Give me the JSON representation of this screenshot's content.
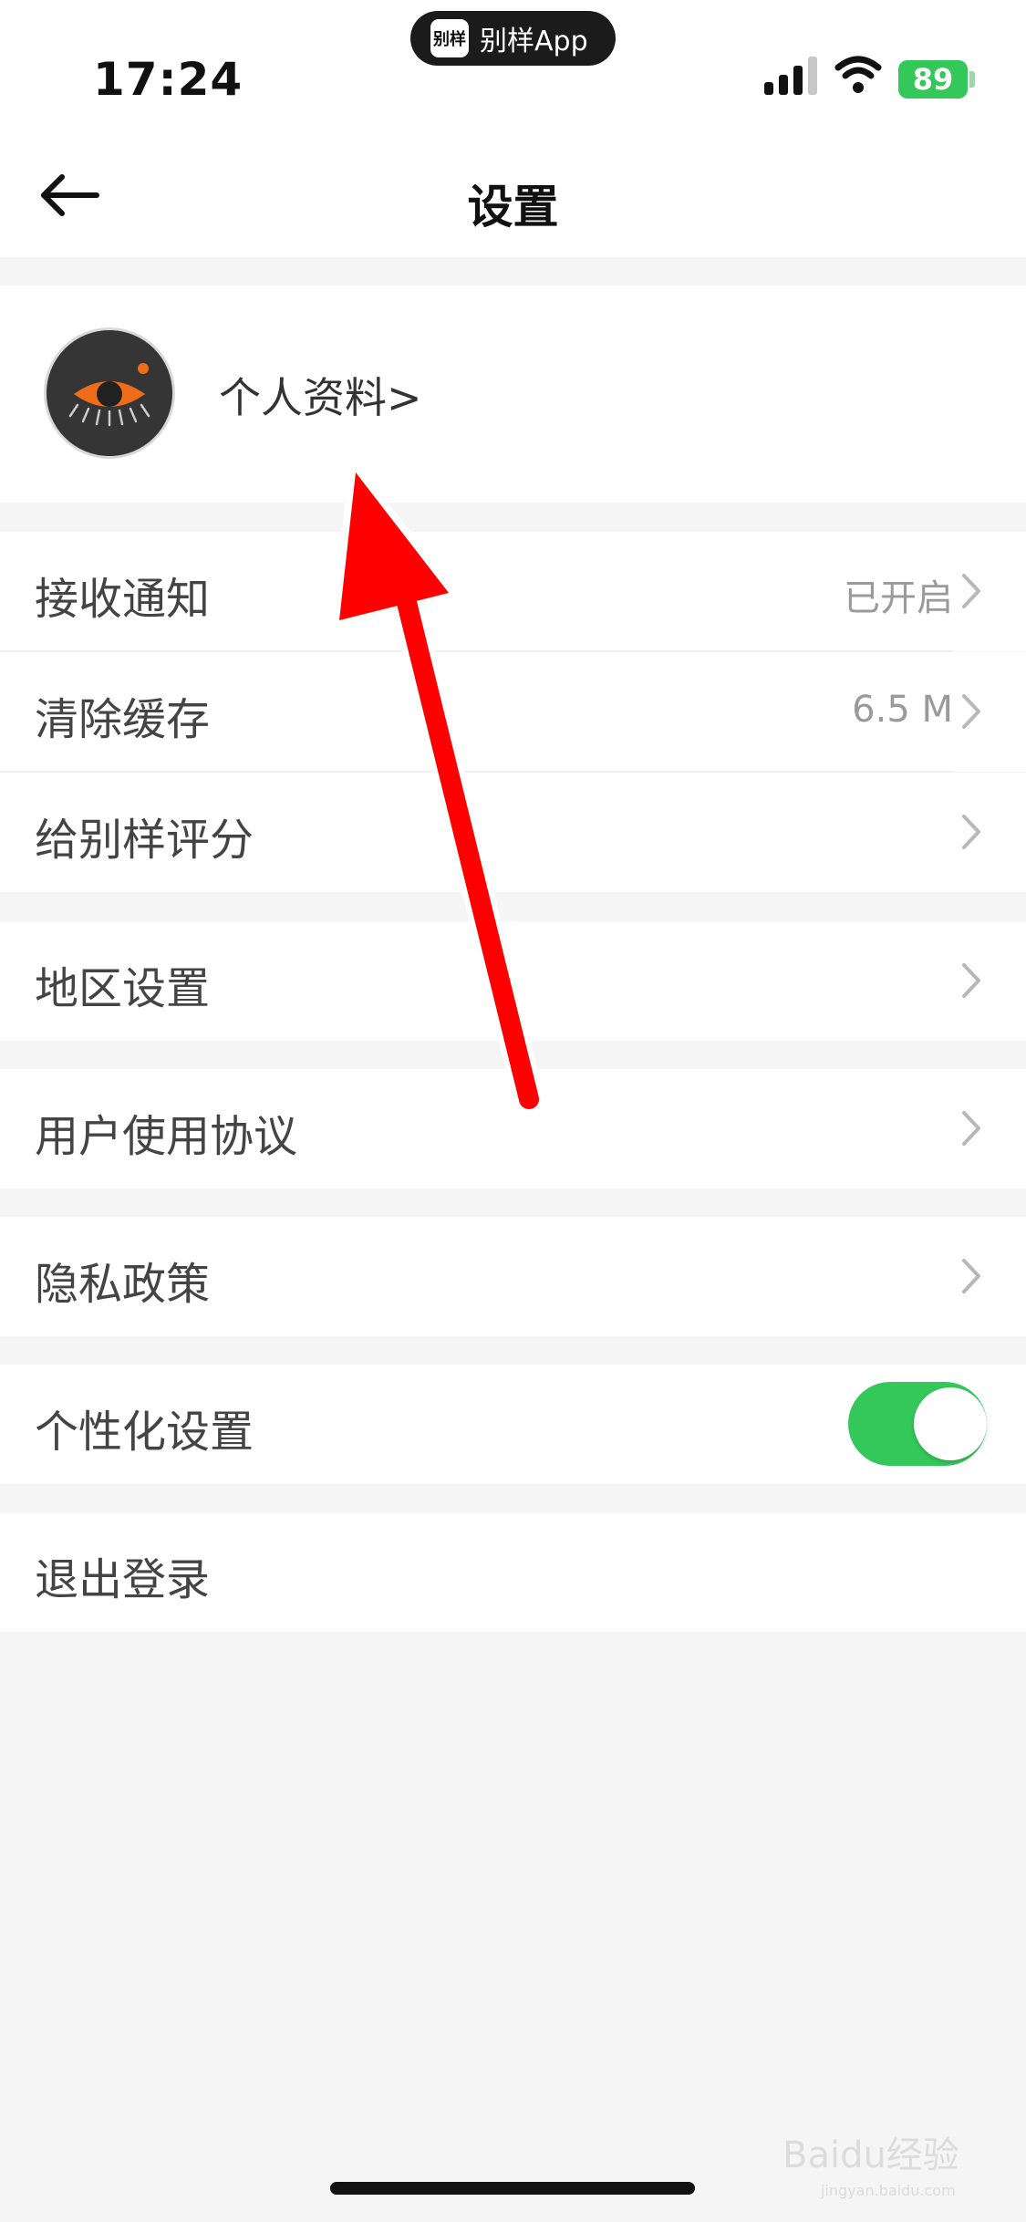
{
  "status_bar": {
    "time": "17:24",
    "island_logo_text": "别样",
    "island_label": "别样App",
    "battery": "89",
    "battery_color": "#34c759"
  },
  "header": {
    "title": "设置",
    "back_icon": "arrow-left-icon"
  },
  "profile": {
    "link_label": "个人资料>",
    "avatar_icon": "eye-logo-icon"
  },
  "settings": {
    "notifications": {
      "label": "接收通知",
      "value": "已开启"
    },
    "clear_cache": {
      "label": "清除缓存",
      "value": "6.5 M"
    },
    "rate_app": {
      "label": "给别样评分"
    },
    "region": {
      "label": "地区设置"
    },
    "user_agreement": {
      "label": "用户使用协议"
    },
    "privacy": {
      "label": "隐私政策"
    },
    "personalization": {
      "label": "个性化设置",
      "enabled": true
    },
    "logout": {
      "label": "退出登录"
    }
  },
  "watermark": {
    "brand": "Baidu经验",
    "url": "jingyan.baidu.com"
  },
  "colors": {
    "accent_toggle": "#34c759",
    "annotation_arrow": "#ff0000",
    "avatar_orange": "#ef6c1a"
  }
}
